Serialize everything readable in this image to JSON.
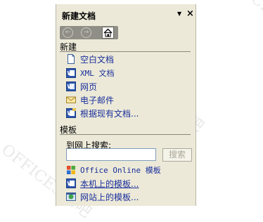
{
  "pane": {
    "title": "新建文档",
    "dropdown_glyph": "▼",
    "close_glyph": "×"
  },
  "nav": {
    "back_icon": "back-arrow-icon",
    "forward_icon": "forward-arrow-icon",
    "home_icon": "home-icon"
  },
  "sections": {
    "new_label": "新建",
    "templates_label": "模板"
  },
  "new_items": [
    {
      "label": "空白文档",
      "icon": "blank-document-icon"
    },
    {
      "label": "XML 文档",
      "icon": "xml-document-icon"
    },
    {
      "label": "网页",
      "icon": "web-page-icon"
    },
    {
      "label": "电子邮件",
      "icon": "email-icon"
    },
    {
      "label": "根据现有文档...",
      "icon": "existing-document-icon"
    }
  ],
  "search": {
    "label": "到网上搜索:",
    "input_value": "",
    "button_label": "搜索"
  },
  "template_items": [
    {
      "label": "Office Online 模板",
      "icon": "office-online-icon"
    },
    {
      "label": "本机上的模板...",
      "icon": "local-templates-icon"
    },
    {
      "label": "网站上的模板...",
      "icon": "website-templates-icon"
    }
  ],
  "watermark": "OFFICE365吧",
  "colors": {
    "pane_bg": "#ece9d8",
    "link": "#1a2f9c",
    "nav_bar": "#8f8e87"
  }
}
